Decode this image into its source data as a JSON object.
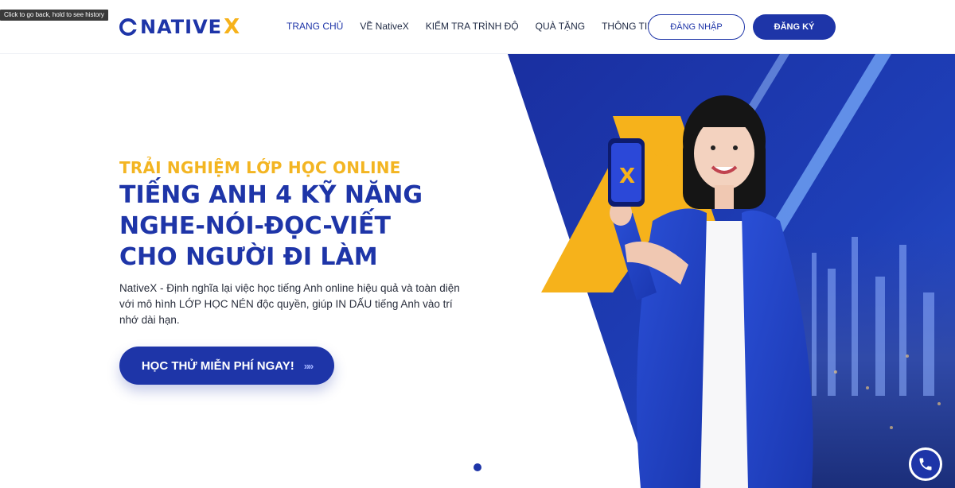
{
  "tooltip": "Click to go back, hold to see history",
  "header": {
    "logo_text": "NATIVE",
    "logo_x": "X",
    "nav": [
      {
        "label": "TRANG CHỦ"
      },
      {
        "label": "VỀ NativeX"
      },
      {
        "label": "KIỂM TRA TRÌNH ĐỘ"
      },
      {
        "label": "QUÀ TẶNG"
      },
      {
        "label": "THÔNG TIN"
      }
    ],
    "login_label": "ĐĂNG NHẬP",
    "register_label": "ĐĂNG KÝ"
  },
  "hero": {
    "subtitle": "TRẢI NGHIỆM LỚP HỌC ONLINE",
    "title_lines": [
      "TIẾNG ANH 4 KỸ NĂNG",
      "NGHE-NÓI-ĐỌC-VIẾT",
      "CHO NGƯỜI ĐI LÀM"
    ],
    "description": "NativeX - Định nghĩa lại việc học tiếng Anh online hiệu quả và toàn diện với mô hình LỚP HỌC NÉN độc quyền, giúp IN DẤU tiếng Anh vào trí nhớ dài hạn.",
    "cta_label": "HỌC THỬ MIỄN PHÍ NGAY!",
    "cta_arrows": "»»",
    "phone_screen_letter": "X"
  },
  "colors": {
    "brand_blue": "#1e35a8",
    "accent_yellow": "#f3b522"
  },
  "icons": {
    "logo": "nativex-logo-icon",
    "phone": "phone-icon",
    "slider_dot": "slider-dot"
  }
}
